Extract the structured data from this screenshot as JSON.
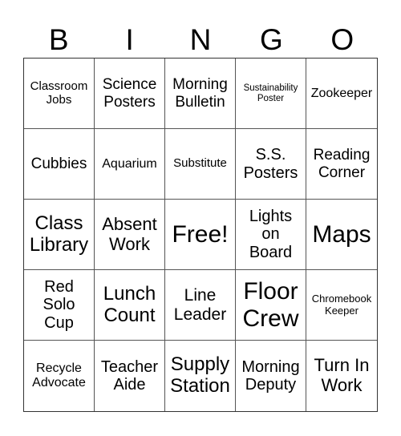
{
  "header": {
    "letters": [
      "B",
      "I",
      "N",
      "G",
      "O"
    ]
  },
  "cells": [
    "Classroom Jobs",
    "Science Posters",
    "Morning Bulletin",
    "Sustainability Poster",
    "Zookeeper",
    "Cubbies",
    "Aquarium",
    "Substitute",
    "S.S. Posters",
    "Reading Corner",
    "Class Library",
    "Absent Work",
    "Free!",
    "Lights on Board",
    "Maps",
    "Red Solo Cup",
    "Lunch Count",
    "Line Leader",
    "Floor Crew",
    "Chromebook Keeper",
    "Recycle Advocate",
    "Teacher Aide",
    "Supply Station",
    "Morning Deputy",
    "Turn In Work"
  ],
  "cell_lines": [
    [
      "Classroom",
      "Jobs"
    ],
    [
      "Science",
      "Posters"
    ],
    [
      "Morning",
      "Bulletin"
    ],
    [
      "Sustainability",
      "Poster"
    ],
    [
      "Zookeeper"
    ],
    [
      "Cubbies"
    ],
    [
      "Aquarium"
    ],
    [
      "Substitute"
    ],
    [
      "S.S.",
      "Posters"
    ],
    [
      "Reading",
      "Corner"
    ],
    [
      "Class",
      "Library"
    ],
    [
      "Absent",
      "Work"
    ],
    [
      "Free!"
    ],
    [
      "Lights",
      "on",
      "Board"
    ],
    [
      "Maps"
    ],
    [
      "Red",
      "Solo",
      "Cup"
    ],
    [
      "Lunch",
      "Count"
    ],
    [
      "Line",
      "Leader"
    ],
    [
      "Floor",
      "Crew"
    ],
    [
      "Chromebook",
      "Keeper"
    ],
    [
      "Recycle",
      "Advocate"
    ],
    [
      "Teacher",
      "Aide"
    ],
    [
      "Supply",
      "Station"
    ],
    [
      "Morning",
      "Deputy"
    ],
    [
      "Turn In",
      "Work"
    ]
  ]
}
